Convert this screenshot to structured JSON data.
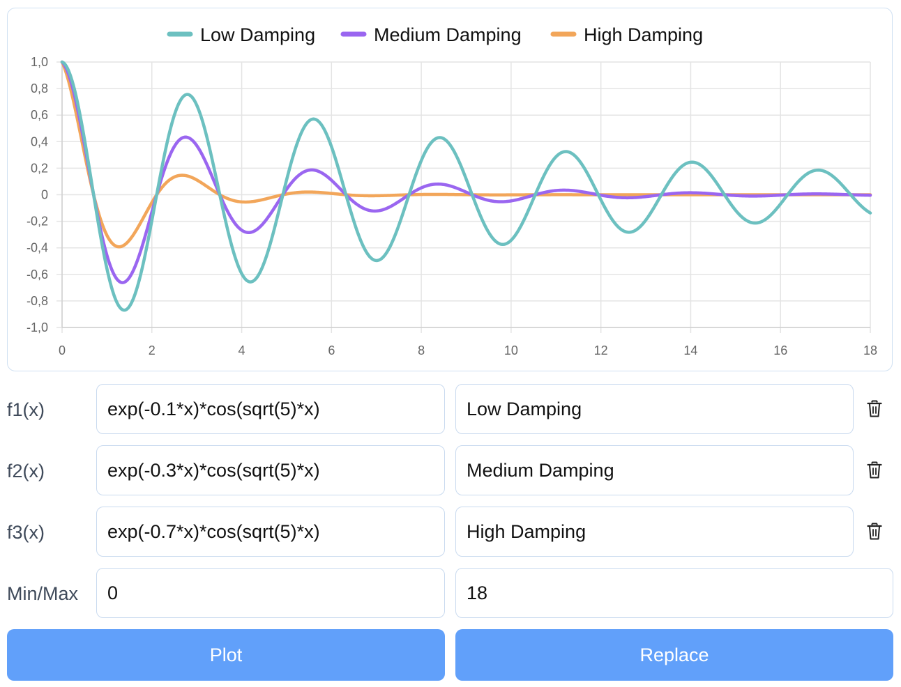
{
  "chart_data": {
    "type": "line",
    "xlim": [
      0,
      18
    ],
    "ylim": [
      -1.0,
      1.0
    ],
    "x_ticks": [
      "0",
      "2",
      "4",
      "6",
      "8",
      "10",
      "12",
      "14",
      "16",
      "18"
    ],
    "y_ticks": [
      "1,0",
      "0,8",
      "0,6",
      "0,4",
      "0,2",
      "0",
      "-0,2",
      "-0,4",
      "-0,6",
      "-0,8",
      "-1,0"
    ],
    "grid": true,
    "legend_position": "top",
    "series": [
      {
        "name": "Low Damping",
        "color": "#6cc0c0",
        "damping": 0.1,
        "omega_sqrt": 5
      },
      {
        "name": "Medium Damping",
        "color": "#9a66f0",
        "damping": 0.3,
        "omega_sqrt": 5
      },
      {
        "name": "High Damping",
        "color": "#f2a65a",
        "damping": 0.7,
        "omega_sqrt": 5
      }
    ]
  },
  "rows": [
    {
      "label": "f1(x)",
      "expr": "exp(-0.1*x)*cos(sqrt(5)*x)",
      "name": "Low Damping"
    },
    {
      "label": "f2(x)",
      "expr": "exp(-0.3*x)*cos(sqrt(5)*x)",
      "name": "Medium Damping"
    },
    {
      "label": "f3(x)",
      "expr": "exp(-0.7*x)*cos(sqrt(5)*x)",
      "name": "High Damping"
    }
  ],
  "range": {
    "label": "Min/Max",
    "min": "0",
    "max": "18"
  },
  "buttons": {
    "plot": "Plot",
    "replace": "Replace"
  },
  "icons": {
    "delete": "trash-icon"
  }
}
